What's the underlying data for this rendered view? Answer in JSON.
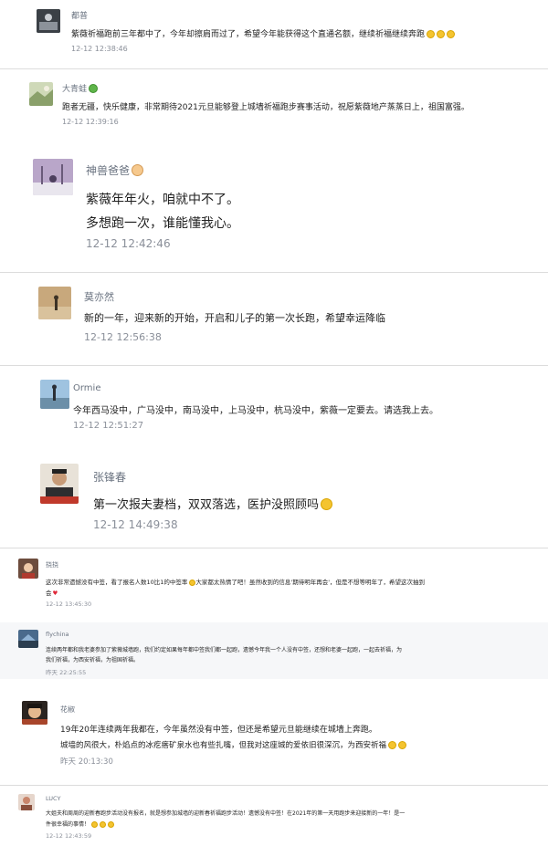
{
  "comments": [
    {
      "user": "都普",
      "text": "紫薇祈福跑前三年都中了，今年却擦肩而过了，希望今年能获得这个直通名额，继续祈福继续奔跑",
      "emoji_count": 3,
      "time": "12-12 12:38:46"
    },
    {
      "user": "大青蛙",
      "user_emoji": "frog-icon",
      "text": "跑者无疆，快乐健康，非常期待2021元旦能够登上城墙祈福跑步赛事活动，祝愿紫薇地产蒸蒸日上，祖国富强。",
      "time": "12-12 12:39:16"
    },
    {
      "user": "神兽爸爸",
      "user_emoji": "child-face-icon",
      "lines": [
        "紫薇年年火，咱就中不了。",
        "多想跑一次，谁能懂我心。"
      ],
      "time": "12-12 12:42:46"
    },
    {
      "user": "莫亦然",
      "text": "新的一年，迎来新的开始，开启和儿子的第一次长跑，希望幸运降临",
      "time": "12-12 12:56:38"
    },
    {
      "user": "Ormie",
      "text": "今年西马没中，广马没中，南马没中，上马没中，杭马没中，紫薇一定要去。请选我上去。",
      "time": "12-12 12:51:27"
    },
    {
      "user": "张锋春",
      "text": "第一次报夫妻档，双双落选，医护没照顾吗",
      "emoji_count": 1,
      "time": "12-12 14:49:38"
    },
    {
      "user": "挠挠",
      "line1": "这次非常遗憾没有中签，看了报名人数10比1的中签率",
      "line1b": "大家都太热情了吧！虽然收到的信息'期待明年再会'，但是不想等明年了，希望这次抽到",
      "line2": "会",
      "time": "12-12 13:45:30"
    },
    {
      "user": "flychina",
      "line1": "连续两年都和我老婆参加了紫薇城墙跑，我们约定如果每年都中签我们都一起跑，遗憾今年我一个人没有中签，还想和老婆一起跑，一起去祈福，为",
      "line2": "我们祈福，为西安祈福，为祖国祈福。",
      "time": "昨天 22:25:55"
    },
    {
      "user": "花椒",
      "lines": [
        "19年20年连续两年我都在，今年虽然没有中签，但还是希望元旦能继续在城墙上奔跑。",
        "城墙的风很大，朴焰点的冰疙瘩矿泉水也有些扎嘴，但我对这座城的爱依旧很深沉，为西安祈福"
      ],
      "emoji_count": 2,
      "time": "昨天 20:13:30"
    },
    {
      "user": "LUCY",
      "line1": "大姐夫和周周的迎新春跑步活动没有报名，就是想参加城墙的迎新春祈福跑步活动！遗憾没有中签！在2021年的第一天用跑步来迎接新的一年！是一",
      "line2": "件很幸福的事情！",
      "emoji_count": 3,
      "time": "12-12 12:43:59"
    }
  ]
}
